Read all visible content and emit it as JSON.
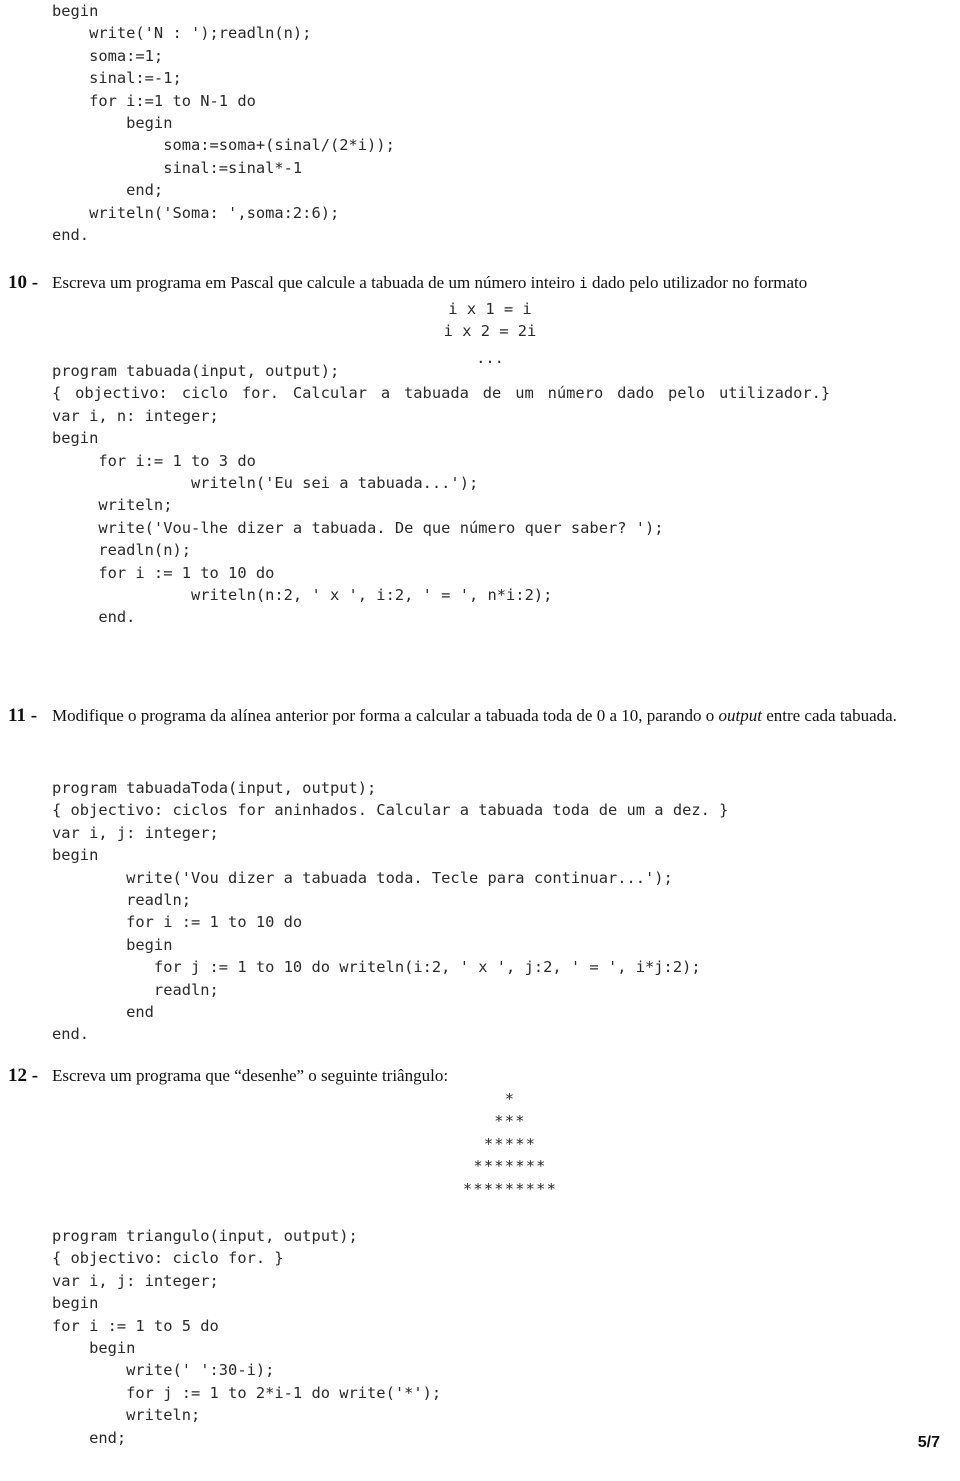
{
  "document": {
    "page_label": "5/7",
    "language": "pt-PT"
  },
  "q9_code": {
    "lines": [
      "begin",
      "    write('N : ');readln(n);",
      "    soma:=1;",
      "    sinal:=-1;",
      "    for i:=1 to N-1 do",
      "        begin",
      "            soma:=soma+(sinal/(2*i));",
      "            sinal:=sinal*-1",
      "        end;",
      "    writeln('Soma: ',soma:2:6);",
      "end."
    ],
    "text": "begin\n    write('N : ');readln(n);\n    soma:=1;\n    sinal:=-1;\n    for i:=1 to N-1 do\n        begin\n            soma:=soma+(sinal/(2*i));\n            sinal:=sinal*-1\n        end;\n    writeln('Soma: ',soma:2:6);\nend."
  },
  "item10": {
    "number": "10 -",
    "text_before_mono": "Escreva um programa em Pascal que calcule a tabuada de um número inteiro ",
    "mono": "i",
    "text_after_mono": " dado pelo utilizador no formato",
    "format_lines": "i x 1 = i\ni x 2 = 2i",
    "format_dots": "...",
    "code_head": "program tabuada(input, output);",
    "code_comment": "{ objectivo: ciclo for. Calcular a tabuada de um número dado pelo utilizador.}",
    "code_rest": "var i, n: integer;\nbegin\n     for i:= 1 to 3 do\n               writeln('Eu sei a tabuada...');\n     writeln;\n     write('Vou-lhe dizer a tabuada. De que número quer saber? ');\n     readln(n);\n     for i := 1 to 10 do\n               writeln(n:2, ' x ', i:2, ' = ', n*i:2);\n     end."
  },
  "item11": {
    "number": "11 -",
    "text_before_italic": "Modifique o programa da alínea anterior por forma a calcular a tabuada toda de 0 a 10, parando o ",
    "italic": "output",
    "text_after_italic": " entre cada tabuada.",
    "code": "program tabuadaToda(input, output);\n{ objectivo: ciclos for aninhados. Calcular a tabuada toda de um a dez. }\nvar i, j: integer;\nbegin\n        write('Vou dizer a tabuada toda. Tecle para continuar...');\n        readln;\n        for i := 1 to 10 do\n        begin\n           for j := 1 to 10 do writeln(i:2, ' x ', j:2, ' = ', i*j:2);\n           readln;\n        end\nend."
  },
  "item12": {
    "number": "12 -",
    "text": "Escreva um programa que “desenhe” o seguinte triângulo:",
    "triangle": "*\n***\n*****\n*******\n*********",
    "triangle_rows": [
      "*",
      "***",
      "*****",
      "*******",
      "*********"
    ],
    "code": "program triangulo(input, output);\n{ objectivo: ciclo for. }\nvar i, j: integer;\nbegin\nfor i := 1 to 5 do\n    begin\n        write(' ':30-i);\n        for j := 1 to 2*i-1 do write('*');\n        writeln;\n    end;"
  },
  "colors": {
    "page_background": "#ffffff",
    "body_text": "#111111",
    "code_text": "#2a2a2a"
  }
}
